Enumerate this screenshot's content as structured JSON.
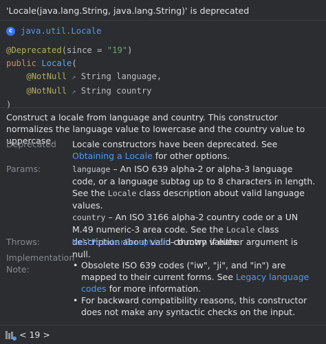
{
  "header": {
    "title": "'Locale(java.lang.String, java.lang.String)' is deprecated"
  },
  "package": {
    "icon_letter": "c",
    "name": "java.util.Locale"
  },
  "signature": {
    "annotation": "@Deprecated",
    "annotation_args_open": "(since = ",
    "since_value": "\"19\"",
    "annotation_args_close": ")",
    "modifier": "public",
    "constructor_name": "Locale",
    "open_paren": "(",
    "param1_annotation": "@NotNull",
    "param1_type": "String",
    "param1_name": "language",
    "param1_comma": ",",
    "param2_annotation": "@NotNull",
    "param2_type": "String",
    "param2_name": "country",
    "close_paren": ")",
    "annotation_arrow": "↗"
  },
  "description": "Construct a locale from language and country. This constructor normalizes the language value to lowercase and the country value to uppercase.",
  "deprecated": {
    "label": "Deprecated",
    "text": "Locale constructors have been deprecated. See ",
    "link": "Obtaining a Locale",
    "text_after": " for other options."
  },
  "params": {
    "label": "Params:",
    "items": [
      {
        "name": "language",
        "text_a": " – An ISO 639 alpha-2 or alpha-3 language code, or a language subtag up to 8 characters in length. See the ",
        "code": "Locale",
        "text_b": " class description about valid language values."
      },
      {
        "name": "country",
        "text_a": " – An ISO 3166 alpha-2 country code or a UN M.49 numeric-3 area code. See the ",
        "code": "Locale",
        "text_b": " class description about valid country values."
      }
    ]
  },
  "throws": {
    "label": "Throws:",
    "exception": "NullPointerException",
    "text": " – thrown if either argument is null."
  },
  "implementation": {
    "label": "Implementation Note:",
    "bullets": [
      {
        "text_a": "Obsolete ISO 639 codes (\"iw\", \"ji\", and \"in\") are mapped to their current forms. See ",
        "link": "Legacy language codes",
        "text_b": " for more information."
      },
      {
        "text_a": "For backward compatibility reasons, this constructor does not make any syntactic checks on the input.",
        "link": "",
        "text_b": ""
      }
    ]
  },
  "footer": {
    "version_prefix": "< ",
    "version": "19",
    "version_suffix": " >"
  },
  "colors": {
    "background": "#2b2d30",
    "link": "#5797f0",
    "annotation": "#b3ae60",
    "keyword": "#cf8e6d",
    "string": "#6aab73"
  }
}
